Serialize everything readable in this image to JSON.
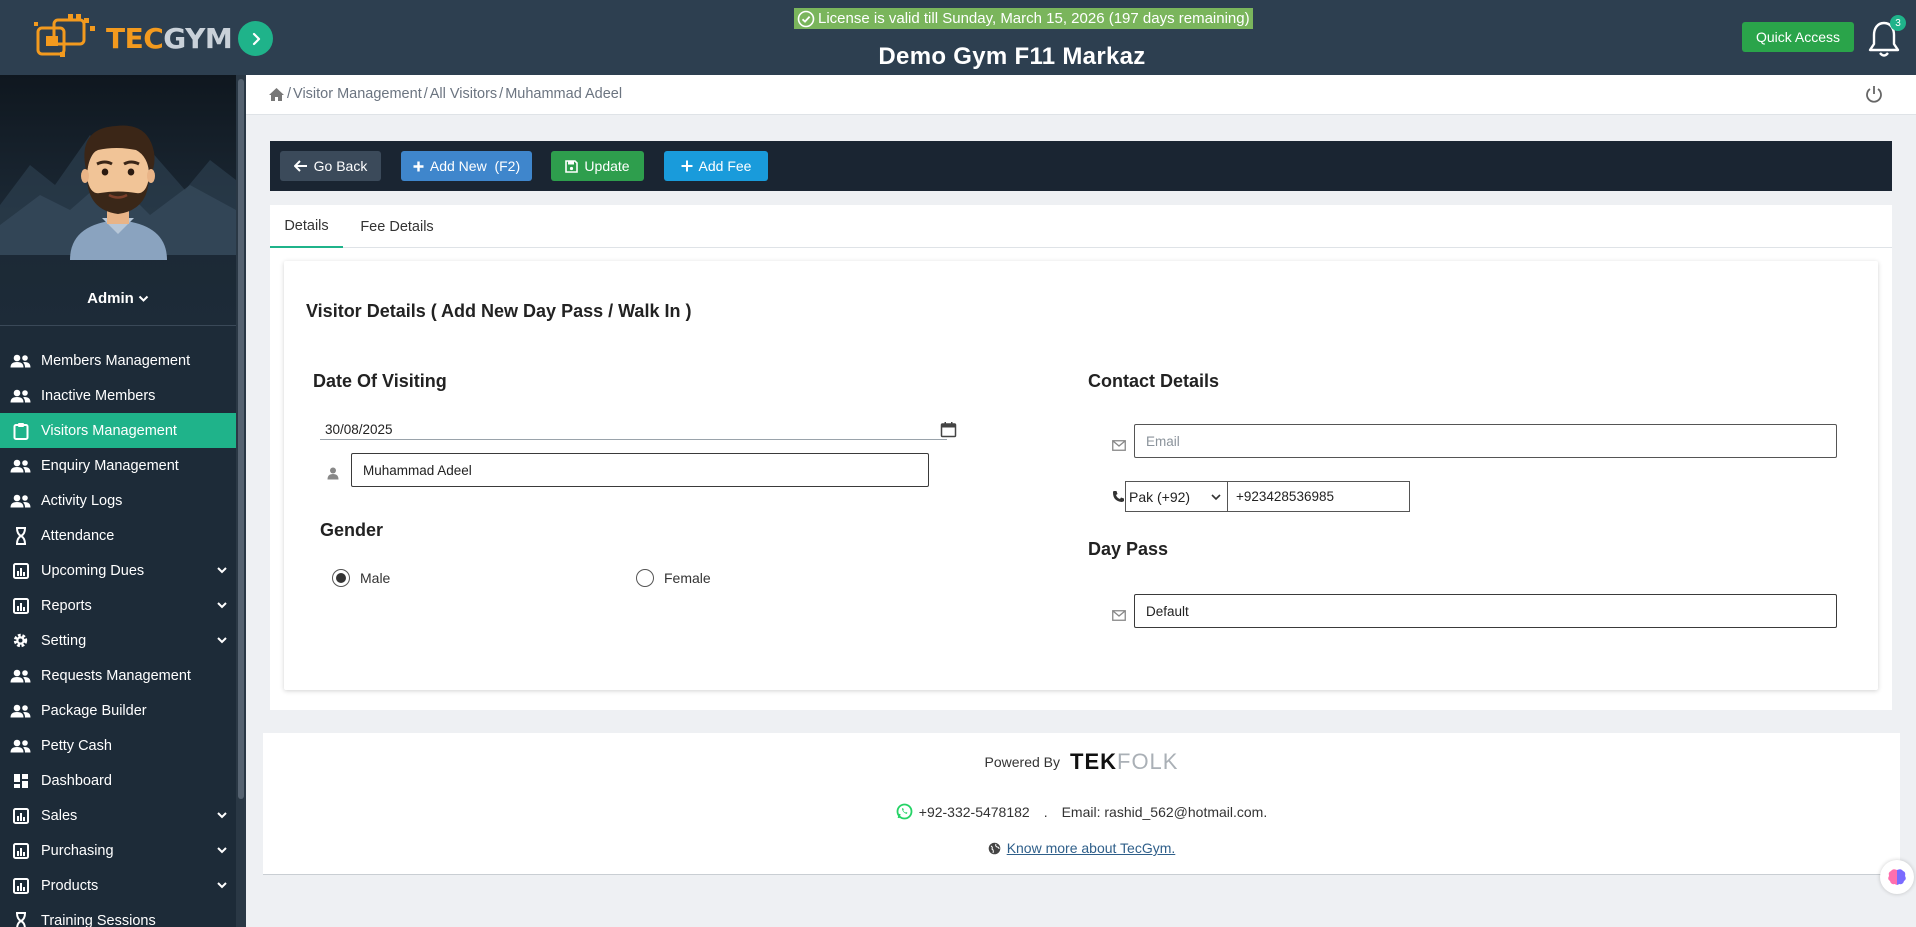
{
  "header": {
    "logo_tec": "TEC",
    "logo_gym": "GYM",
    "license_text": "License is valid till Sunday, March 15, 2026 (197 days remaining)",
    "gym_name": "Demo Gym F11 Markaz",
    "quick_access": "Quick Access",
    "notification_count": "3"
  },
  "sidebar": {
    "user": "Admin",
    "items": [
      {
        "label": "Members Management",
        "icon": "users-icon",
        "active": false,
        "expandable": false
      },
      {
        "label": "Inactive Members",
        "icon": "users-icon",
        "active": false,
        "expandable": false
      },
      {
        "label": "Visitors Management",
        "icon": "clipboard-icon",
        "active": true,
        "expandable": false
      },
      {
        "label": "Enquiry Management",
        "icon": "users-icon",
        "active": false,
        "expandable": false
      },
      {
        "label": "Activity Logs",
        "icon": "users-icon",
        "active": false,
        "expandable": false
      },
      {
        "label": "Attendance",
        "icon": "hourglass-icon",
        "active": false,
        "expandable": false
      },
      {
        "label": "Upcoming Dues",
        "icon": "chart-icon",
        "active": false,
        "expandable": true
      },
      {
        "label": "Reports",
        "icon": "chart-icon",
        "active": false,
        "expandable": true
      },
      {
        "label": "Setting",
        "icon": "gear-icon",
        "active": false,
        "expandable": true
      },
      {
        "label": "Requests Management",
        "icon": "users-icon",
        "active": false,
        "expandable": false
      },
      {
        "label": "Package Builder",
        "icon": "users-icon",
        "active": false,
        "expandable": false
      },
      {
        "label": "Petty Cash",
        "icon": "users-icon",
        "active": false,
        "expandable": false
      },
      {
        "label": "Dashboard",
        "icon": "dashboard-icon",
        "active": false,
        "expandable": false
      },
      {
        "label": "Sales",
        "icon": "chart-icon",
        "active": false,
        "expandable": true
      },
      {
        "label": "Purchasing",
        "icon": "chart-icon",
        "active": false,
        "expandable": true
      },
      {
        "label": "Products",
        "icon": "chart-icon",
        "active": false,
        "expandable": true
      },
      {
        "label": "Training Sessions",
        "icon": "hourglass-icon",
        "active": false,
        "expandable": false
      }
    ]
  },
  "breadcrumb": {
    "items": [
      "Visitor Management",
      "All Visitors",
      "Muhammad Adeel"
    ],
    "separator": "/"
  },
  "actions": {
    "go_back": "Go Back",
    "add_new": "Add New  (F2)",
    "update": "Update",
    "add_fee": "Add Fee"
  },
  "tabs": {
    "details": "Details",
    "fee_details": "Fee Details"
  },
  "form": {
    "heading": "Visitor Details ( Add New Day Pass / Walk In )",
    "date_section": "Date Of Visiting",
    "date_value": "30/08/2025",
    "name_value": "Muhammad Adeel",
    "gender_section": "Gender",
    "gender_male": "Male",
    "gender_female": "Female",
    "gender_selected": "Male",
    "contact_section": "Contact Details",
    "email_placeholder": "Email",
    "country_code": "Pak (+92)",
    "phone_value": "+923428536985",
    "day_pass_section": "Day Pass",
    "day_pass_value": "Default"
  },
  "footer": {
    "powered_by": "Powered By",
    "brand_tek": "TEK",
    "brand_folk": "FOLK",
    "phone": "+92-332-5478182",
    "dot": ".",
    "email": "Email: rashid_562@hotmail.com.",
    "know_more": "Know more about TecGym."
  },
  "colors": {
    "accent": "#1fb38a",
    "header_bg": "#2d3f50",
    "sidebar_bg": "#1d2b38",
    "action_bar_bg": "#1a2532"
  }
}
